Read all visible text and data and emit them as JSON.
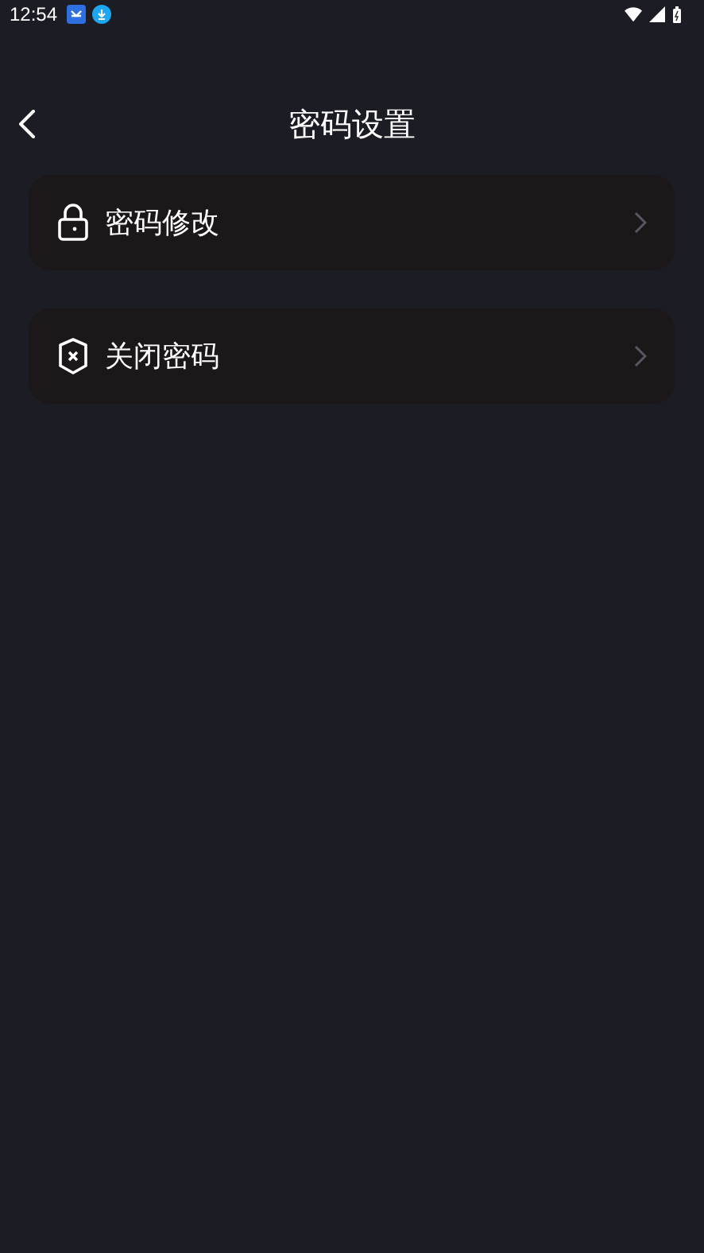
{
  "status_bar": {
    "time": "12:54"
  },
  "header": {
    "title": "密码设置"
  },
  "items": [
    {
      "kind": "lock",
      "label": "密码修改"
    },
    {
      "kind": "shield",
      "label": "关闭密码"
    }
  ]
}
